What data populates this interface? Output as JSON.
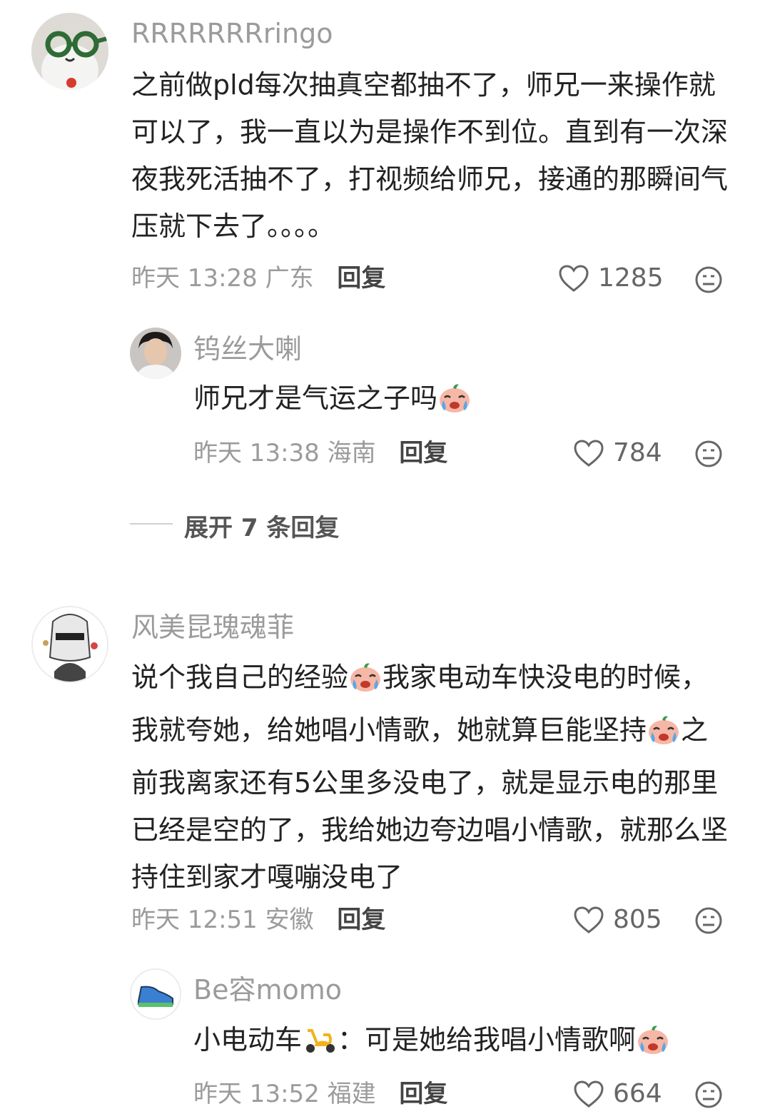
{
  "comments": [
    {
      "username": "RRRRRRRringo",
      "text": "之前做pld每次抽真空都抽不了，师兄一来操作就可以了，我一直以为是操作不到位。直到有一次深夜我死活抽不了，打视频给师兄，接通的那瞬间气压就下去了。。。。",
      "time": "昨天 13:28",
      "location": "广东",
      "reply_label": "回复",
      "likes": "1285",
      "replies": [
        {
          "username": "钨丝大喇",
          "text": "师兄才是气运之子吗",
          "emoji": "crying-face-icon",
          "time": "昨天 13:38",
          "location": "海南",
          "reply_label": "回复",
          "likes": "784"
        }
      ],
      "expand_label": "展开 7 条回复"
    },
    {
      "username": "风美昆瑰魂菲",
      "text_part1": "说个我自己的经验",
      "text_part2": "我家电动车快没电的时候，我就夸她，给她唱小情歌，她就算巨能坚持",
      "text_part3": "之前我离家还有5公里多没电了，就是显示电的那里已经是空的了，我给她边夸边唱小情歌，就那么坚持住到家才嘎嘣没电了",
      "time": "昨天 12:51",
      "location": "安徽",
      "reply_label": "回复",
      "likes": "805",
      "replies": [
        {
          "username": "Be容momo",
          "text_part1": "小电动车",
          "text_part2": "：可是她给我唱小情歌啊",
          "time": "昨天 13:52",
          "location": "福建",
          "reply_label": "回复",
          "likes": "664"
        }
      ]
    }
  ],
  "colors": {
    "muted": "#9b9b9b",
    "text": "#222222",
    "reply": "#444444"
  },
  "icons": [
    "heart-outline-icon",
    "dislike-face-icon",
    "crying-face-icon",
    "scooter-icon"
  ]
}
